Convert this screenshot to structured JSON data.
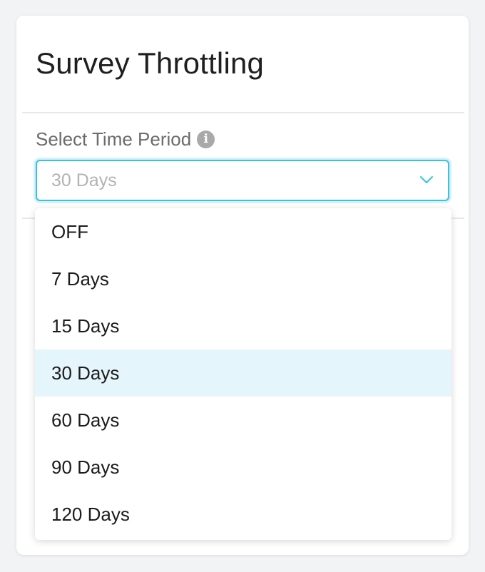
{
  "card": {
    "title": "Survey Throttling"
  },
  "field": {
    "label": "Select Time Period",
    "info_glyph": "i",
    "selected_value": "30 Days"
  },
  "dropdown": {
    "options": [
      {
        "label": "OFF",
        "selected": false
      },
      {
        "label": "7 Days",
        "selected": false
      },
      {
        "label": "15 Days",
        "selected": false
      },
      {
        "label": "30 Days",
        "selected": true
      },
      {
        "label": "60 Days",
        "selected": false
      },
      {
        "label": "90 Days",
        "selected": false
      },
      {
        "label": "120 Days",
        "selected": false
      }
    ]
  },
  "colors": {
    "accent": "#33c3e6",
    "selected_bg": "#e5f5fc",
    "label_text": "#6b6b6b",
    "placeholder_text": "#b3b3b3"
  },
  "icons": {
    "info": "info-icon",
    "chevron": "chevron-down-icon"
  }
}
